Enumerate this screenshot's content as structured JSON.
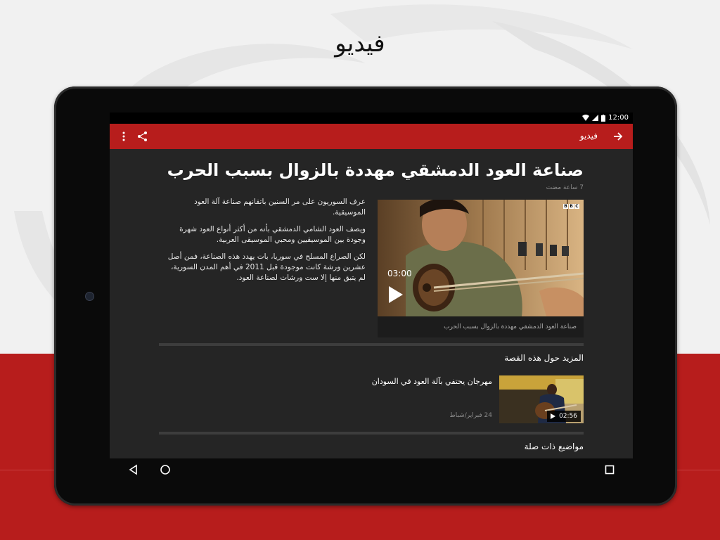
{
  "promo": {
    "title": "فيديو"
  },
  "status_bar": {
    "time": "12:00"
  },
  "app_bar": {
    "title": "فيديو",
    "back_icon": "arrow-right-icon",
    "share_icon": "share-icon",
    "menu_icon": "more-vert-icon"
  },
  "article": {
    "headline": "صناعة العود الدمشقي مهددة بالزوال بسبب الحرب",
    "timestamp": "7 ساعة مضت",
    "paragraphs": [
      "عرف السوريون على مر السنين باتقانهم صناعة آلة العود الموسيقية.",
      "ويصف العود الشامي الدمشقي بأنه من أكثر أنواع العود شهرة وجودة بين الموسيقيين ومحبي الموسيقى العربية.",
      "لكن الصراع المسلح في سوريا، بات يهدد هذه الصناعة، فمن أصل عشرين ورشة كانت موجودة قبل 2011 في أهم المدن السورية، لم يتبق منها إلا ست ورشات لصناعة العود."
    ],
    "video": {
      "duration": "03:00",
      "caption": "صناعة العود الدمشقي مهددة بالزوال بسبب الحرب",
      "brand": [
        "B",
        "B",
        "C"
      ]
    }
  },
  "more_stories": {
    "heading": "المزيد حول هذه القصة",
    "items": [
      {
        "title": "مهرجان يحتفي بآلة العود في السودان",
        "date": "24 فبراير/شباط",
        "duration": "02:56"
      }
    ]
  },
  "related": {
    "heading": "مواضيع ذات صلة"
  },
  "colors": {
    "brand_red": "#b71d1c",
    "screen_bg": "#252525",
    "page_bg": "#f1f1f1"
  }
}
